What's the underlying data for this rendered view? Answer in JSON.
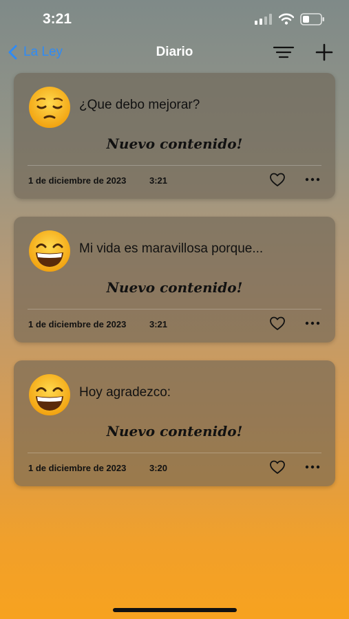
{
  "status_bar": {
    "time": "3:21"
  },
  "nav": {
    "back_label": "La Ley",
    "title": "Diario",
    "back_icon": "chevron-left-icon",
    "filter_icon": "filter-lines-icon",
    "add_icon": "plus-icon"
  },
  "colors": {
    "accent": "#2f8bf5",
    "gradient_top": "#7f8a88",
    "gradient_bottom": "#f7a21f"
  },
  "entries": [
    {
      "emoji": "pensive-face",
      "prompt": "¿Que debo mejorar?",
      "content": "Nuevo contenido!",
      "date": "1 de diciembre de 2023",
      "time": "3:21"
    },
    {
      "emoji": "grinning-face",
      "prompt": "Mi vida es maravillosa porque...",
      "content": "Nuevo contenido!",
      "date": "1 de diciembre de 2023",
      "time": "3:21"
    },
    {
      "emoji": "grinning-face",
      "prompt": "Hoy agradezco:",
      "content": "Nuevo contenido!",
      "date": "1 de diciembre de 2023",
      "time": "3:20"
    }
  ]
}
